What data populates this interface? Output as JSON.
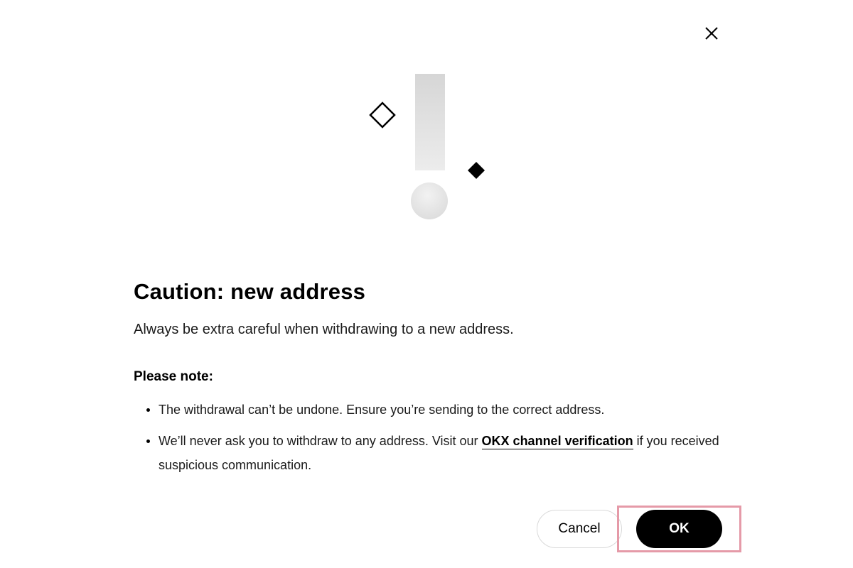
{
  "dialog": {
    "title": "Caution: new address",
    "subtitle": "Always be extra careful when withdrawing to a new address.",
    "close_icon": "close-icon",
    "illustration_icon": "exclamation-warning-icon",
    "note": {
      "heading": "Please note:",
      "bullet_1": "The withdrawal can’t be undone. Ensure you’re sending to the correct address.",
      "bullet_2_before": "We’ll never ask you to withdraw to any address. Visit our ",
      "bullet_2_link": "OKX channel verification",
      "bullet_2_after": " if you received suspicious communication."
    },
    "buttons": {
      "cancel_label": "Cancel",
      "ok_label": "OK"
    },
    "colors": {
      "primary_button": "#000000",
      "highlight_outline": "#e59aa8"
    }
  }
}
